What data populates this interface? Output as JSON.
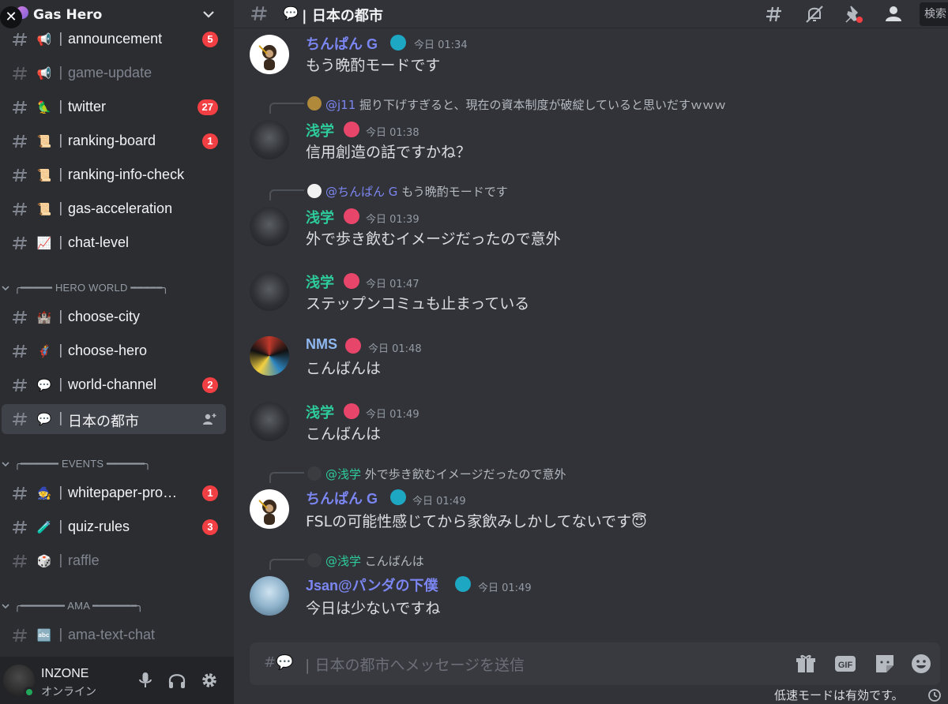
{
  "server": {
    "name": "Gas Hero",
    "close_label": "✕"
  },
  "channels": [
    {
      "emoji": "📢",
      "name": "announcement",
      "badge": "5",
      "muted": false
    },
    {
      "emoji": "📢",
      "name": "game-update",
      "badge": "",
      "muted": true
    },
    {
      "emoji": "🦜",
      "name": "twitter",
      "badge": "27",
      "muted": false
    },
    {
      "emoji": "📜",
      "name": "ranking-board",
      "badge": "1",
      "muted": false
    },
    {
      "emoji": "📜",
      "name": "ranking-info-check",
      "badge": "",
      "muted": false
    },
    {
      "emoji": "📜",
      "name": "gas-acceleration",
      "badge": "",
      "muted": false
    },
    {
      "emoji": "📈",
      "name": "chat-level",
      "badge": "",
      "muted": false
    }
  ],
  "categories": {
    "hero_world": "╭━━━━━ HERO WORLD ━━━━━╮",
    "events": "╭━━━━━━ EVENTS ━━━━━━╮",
    "ama": "╭━━━━━━━ AMA ━━━━━━━╮"
  },
  "hero_world_channels": [
    {
      "emoji": "🏰",
      "name": "choose-city",
      "badge": ""
    },
    {
      "emoji": "🦸",
      "name": "choose-hero",
      "badge": ""
    },
    {
      "emoji": "💬",
      "name": "world-channel",
      "badge": "2"
    },
    {
      "emoji": "💬",
      "name": "日本の都市",
      "badge": ""
    }
  ],
  "event_channels": [
    {
      "emoji": "🧙",
      "name": "whitepaper-pro…",
      "badge": "1"
    },
    {
      "emoji": "🧪",
      "name": "quiz-rules",
      "badge": "3"
    },
    {
      "emoji": "🎲",
      "name": "raffle",
      "badge": ""
    }
  ],
  "ama_channels": [
    {
      "emoji": "🔤",
      "name": "ama-text-chat",
      "badge": ""
    }
  ],
  "user": {
    "name": "INZONE",
    "status": "オンライン"
  },
  "header": {
    "emoji": "💬",
    "title": "| 日本の都市",
    "search": "検索"
  },
  "messages": [
    {
      "author": "ちんぱん G",
      "time": "今日 01:34",
      "text": "もう晩酌モードです",
      "reply": null
    },
    {
      "author": "浅学",
      "time": "今日 01:38",
      "text": "信用創造の話ですかね？",
      "reply": {
        "author": "@j11",
        "text": "掘り下げすぎると、現在の資本制度が破綻していると思いだすｗｗｗ"
      }
    },
    {
      "author": "浅学",
      "time": "今日 01:39",
      "text": "外で歩き飲むイメージだったので意外",
      "reply": {
        "author": "@ちんぱん G",
        "text": "もう晩酌モードです"
      }
    },
    {
      "author": "浅学",
      "time": "今日 01:47",
      "text": "ステップンコミュも止まっている",
      "reply": null
    },
    {
      "author": "NMS",
      "time": "今日 01:48",
      "text": "こんばんは",
      "reply": null
    },
    {
      "author": "浅学",
      "time": "今日 01:49",
      "text": "こんばんは",
      "reply": null
    },
    {
      "author": "ちんぱん G",
      "time": "今日 01:49",
      "text": "FSLの可能性感じてから家飲みしかしてないです😇",
      "reply": {
        "author": "@浅学",
        "text": "外で歩き飲むイメージだったので意外"
      }
    },
    {
      "author": "Jsan@パンダの下僕",
      "time": "今日 01:49",
      "text": "今日は少ないですね",
      "reply": {
        "author": "@浅学",
        "text": "こんばんは"
      }
    }
  ],
  "composer": {
    "prefix": "#💬",
    "placeholder": "| 日本の都市へメッセージを送信"
  },
  "slowmode": "低速モードは有効です。",
  "colors": {
    "background": "#313338",
    "sidebar": "#2b2d31",
    "badge": "#f23f43",
    "author_blue": "#7c86f2",
    "author_teal": "#2ecc9a",
    "author_nms": "#8fb8f0",
    "online": "#23a55a"
  },
  "icons": {
    "header": [
      "threads-icon",
      "mute-bell-icon",
      "pin-icon",
      "members-icon"
    ],
    "composer": [
      "gift-icon",
      "gif-icon",
      "sticker-icon",
      "emoji-icon"
    ],
    "user_controls": [
      "microphone-icon",
      "headphones-icon",
      "gear-icon"
    ]
  }
}
